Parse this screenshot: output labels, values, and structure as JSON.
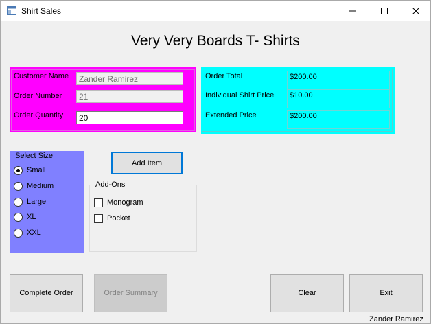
{
  "window": {
    "title": "Shirt Sales",
    "minimize_glyph": "—",
    "maximize_glyph": "☐",
    "close_glyph": "✕"
  },
  "heading": "Very Very Boards T- Shirts",
  "customer": {
    "name_label": "Customer Name",
    "name_value": "Zander Ramirez",
    "order_number_label": "Order Number",
    "order_number_value": "21",
    "quantity_label": "Order Quantity",
    "quantity_value": "20"
  },
  "order": {
    "total_label": "Order Total",
    "total_value": "$200.00",
    "shirt_price_label": "Individual Shirt Price",
    "shirt_price_value": "$10.00",
    "extended_label": "Extended Price",
    "extended_value": "$200.00"
  },
  "size_group": {
    "title": "Select Size",
    "options": [
      "Small",
      "Medium",
      "Large",
      "XL",
      "XXL"
    ],
    "selected": "Small"
  },
  "add_item_label": "Add Item",
  "addons": {
    "title": "Add-Ons",
    "options": [
      "Monogram",
      "Pocket"
    ]
  },
  "buttons": {
    "complete": "Complete Order",
    "summary": "Order Summary",
    "clear": "Clear",
    "exit": "Exit"
  },
  "footer_name": "Zander Ramirez",
  "colors": {
    "customer_panel": "#ff00ff",
    "order_panel": "#00ffff",
    "size_panel": "#8080ff"
  }
}
